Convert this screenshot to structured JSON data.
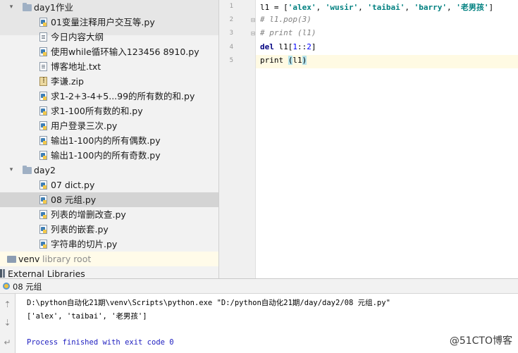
{
  "project_tree": {
    "items": [
      {
        "kind": "folder",
        "indent": 1,
        "expanded": true,
        "label": "day1作业"
      },
      {
        "kind": "py",
        "indent": 2,
        "label": "01变量注释用户交互等.py"
      },
      {
        "kind": "txt",
        "indent": 2,
        "label": "今日内容大纲"
      },
      {
        "kind": "py",
        "indent": 2,
        "label": "使用while循环输入123456 8910.py"
      },
      {
        "kind": "txt",
        "indent": 2,
        "label": "博客地址.txt"
      },
      {
        "kind": "zip",
        "indent": 2,
        "label": "李谦.zip"
      },
      {
        "kind": "py",
        "indent": 2,
        "label": "求1-2+3-4+5...99的所有数的和.py"
      },
      {
        "kind": "py",
        "indent": 2,
        "label": "求1-100所有数的和.py"
      },
      {
        "kind": "py",
        "indent": 2,
        "label": "用户登录三次.py"
      },
      {
        "kind": "py",
        "indent": 2,
        "label": "输出1-100内的所有偶数.py"
      },
      {
        "kind": "py",
        "indent": 2,
        "label": "输出1-100内的所有奇数.py"
      },
      {
        "kind": "folder",
        "indent": 1,
        "expanded": true,
        "label": "day2"
      },
      {
        "kind": "py",
        "indent": 2,
        "label": "07 dict.py"
      },
      {
        "kind": "py",
        "indent": 2,
        "label": "08 元组.py",
        "selected": true
      },
      {
        "kind": "py",
        "indent": 2,
        "label": "列表的增删改查.py"
      },
      {
        "kind": "py",
        "indent": 2,
        "label": "列表的嵌套.py"
      },
      {
        "kind": "py",
        "indent": 2,
        "label": "字符串的切片.py"
      },
      {
        "kind": "venv",
        "indent": 0,
        "label": "venv",
        "suffix": "library root"
      },
      {
        "kind": "lib",
        "indent": -1,
        "label": "External Libraries"
      }
    ]
  },
  "editor": {
    "line_numbers": [
      "1",
      "2",
      "3",
      "4",
      "5"
    ],
    "current_line": 5,
    "lines": [
      [
        {
          "t": "l1 = [",
          "c": ""
        },
        {
          "t": "'alex'",
          "c": "str"
        },
        {
          "t": ", ",
          "c": ""
        },
        {
          "t": "'wusir'",
          "c": "str"
        },
        {
          "t": ", ",
          "c": ""
        },
        {
          "t": "'taibai'",
          "c": "str"
        },
        {
          "t": ", ",
          "c": ""
        },
        {
          "t": "'barry'",
          "c": "str"
        },
        {
          "t": ", ",
          "c": ""
        },
        {
          "t": "'老男孩'",
          "c": "str"
        },
        {
          "t": "]",
          "c": ""
        }
      ],
      [
        {
          "t": "# l1.pop(3)",
          "c": "cmt"
        }
      ],
      [
        {
          "t": "# print (l1)",
          "c": "cmt"
        }
      ],
      [
        {
          "t": "del ",
          "c": "kw"
        },
        {
          "t": "l1[",
          "c": ""
        },
        {
          "t": "1",
          "c": "num"
        },
        {
          "t": "::",
          "c": ""
        },
        {
          "t": "2",
          "c": "num"
        },
        {
          "t": "]",
          "c": ""
        }
      ],
      [
        {
          "t": "print ",
          "c": ""
        },
        {
          "t": "(",
          "c": "paren-hl"
        },
        {
          "t": "l1",
          "c": ""
        },
        {
          "t": ")",
          "c": "paren-hl"
        }
      ]
    ]
  },
  "run_panel": {
    "tab_title": "08 元组",
    "console_lines": [
      {
        "text": "D:\\python自动化21期\\venv\\Scripts\\python.exe \"D:/python自动化21期/day/day2/08 元组.py\"",
        "kind": "cmd"
      },
      {
        "text": "['alex', 'taibai', '老男孩']",
        "kind": "out"
      },
      {
        "text": "",
        "kind": "blank"
      },
      {
        "text": "Process finished with exit code 0",
        "kind": "proc"
      }
    ]
  },
  "watermark": "@51CTO博客",
  "colors": {
    "string": "#008080",
    "keyword": "#000080",
    "number": "#0000ff",
    "comment": "#808080",
    "process": "#1c1cbf",
    "selection": "#d4d4d4",
    "current_line": "#fffae3"
  }
}
